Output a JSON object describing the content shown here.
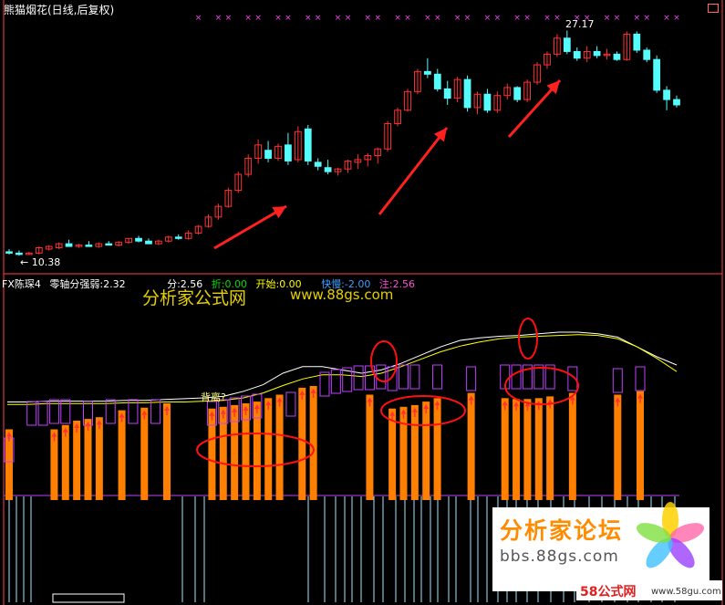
{
  "title": "熊猫烟花(日线,后复权)",
  "price_high_label": "27.17",
  "price_low_label": "10.38",
  "indicator": {
    "name": "FX陈琛4",
    "zero_axis": "零轴分强弱:2.32",
    "fen": "分:2.56",
    "zhe": "折:0.00",
    "kaishi": "开始:0.00",
    "kuaiman": "快慢:-2.00",
    "zhu": "注:2.56"
  },
  "watermark_cn": "分析家公式网",
  "watermark_url": "www.88gs.com",
  "divergence_label": "背离?",
  "forum_logo": {
    "title": "分析家论坛",
    "url": "bbs.88gs.com"
  },
  "badge": {
    "brand": "58公式网",
    "url": "www.58gu.com"
  },
  "colors": {
    "up_candle": "#ff3232",
    "down_candle": "#54fcfc",
    "ma_white": "#ffffff",
    "ma_yellow": "#ffff00",
    "bar_orange": "#ff7f00",
    "box_magenta": "#c040ff",
    "arrow_red": "#ff2020",
    "marker_magenta": "#ff40ff"
  },
  "chart_data": {
    "type": "candlestick",
    "annotation_high": 27.17,
    "annotation_low": 10.38,
    "candles": [
      {
        "o": 10.6,
        "h": 10.8,
        "l": 10.4,
        "c": 10.5
      },
      {
        "o": 10.5,
        "h": 10.7,
        "l": 10.3,
        "c": 10.4
      },
      {
        "o": 10.4,
        "h": 10.6,
        "l": 10.38,
        "c": 10.5
      },
      {
        "o": 10.5,
        "h": 11.0,
        "l": 10.4,
        "c": 10.9
      },
      {
        "o": 10.8,
        "h": 11.1,
        "l": 10.7,
        "c": 11.0
      },
      {
        "o": 10.9,
        "h": 11.3,
        "l": 10.8,
        "c": 11.2
      },
      {
        "o": 11.2,
        "h": 11.5,
        "l": 11.0,
        "c": 11.0
      },
      {
        "o": 11.0,
        "h": 11.2,
        "l": 10.9,
        "c": 11.1
      },
      {
        "o": 11.1,
        "h": 11.4,
        "l": 11.0,
        "c": 11.0
      },
      {
        "o": 11.0,
        "h": 11.3,
        "l": 10.9,
        "c": 11.2
      },
      {
        "o": 11.2,
        "h": 11.4,
        "l": 11.1,
        "c": 11.1
      },
      {
        "o": 11.1,
        "h": 11.4,
        "l": 11.0,
        "c": 11.3
      },
      {
        "o": 11.3,
        "h": 11.6,
        "l": 11.2,
        "c": 11.6
      },
      {
        "o": 11.6,
        "h": 11.8,
        "l": 11.3,
        "c": 11.4
      },
      {
        "o": 11.4,
        "h": 11.6,
        "l": 11.2,
        "c": 11.2
      },
      {
        "o": 11.2,
        "h": 11.5,
        "l": 11.1,
        "c": 11.4
      },
      {
        "o": 11.4,
        "h": 11.8,
        "l": 11.3,
        "c": 11.7
      },
      {
        "o": 11.7,
        "h": 11.9,
        "l": 11.5,
        "c": 11.6
      },
      {
        "o": 11.6,
        "h": 12.2,
        "l": 11.5,
        "c": 12.0
      },
      {
        "o": 12.0,
        "h": 12.6,
        "l": 11.9,
        "c": 12.5
      },
      {
        "o": 12.5,
        "h": 13.4,
        "l": 12.4,
        "c": 13.2
      },
      {
        "o": 13.2,
        "h": 14.2,
        "l": 13.0,
        "c": 14.0
      },
      {
        "o": 14.0,
        "h": 15.4,
        "l": 13.9,
        "c": 15.2
      },
      {
        "o": 15.2,
        "h": 16.6,
        "l": 15.0,
        "c": 16.4
      },
      {
        "o": 16.4,
        "h": 17.9,
        "l": 16.2,
        "c": 17.6
      },
      {
        "o": 17.6,
        "h": 19.0,
        "l": 17.2,
        "c": 18.6
      },
      {
        "o": 18.2,
        "h": 18.9,
        "l": 17.3,
        "c": 17.6
      },
      {
        "o": 17.6,
        "h": 18.7,
        "l": 17.4,
        "c": 18.5
      },
      {
        "o": 18.6,
        "h": 19.5,
        "l": 17.1,
        "c": 17.4
      },
      {
        "o": 17.5,
        "h": 20.0,
        "l": 17.3,
        "c": 19.6
      },
      {
        "o": 19.8,
        "h": 20.1,
        "l": 17.1,
        "c": 17.4
      },
      {
        "o": 17.3,
        "h": 17.6,
        "l": 16.7,
        "c": 17.0
      },
      {
        "o": 16.9,
        "h": 17.5,
        "l": 16.4,
        "c": 16.6
      },
      {
        "o": 16.6,
        "h": 16.9,
        "l": 16.3,
        "c": 16.8
      },
      {
        "o": 16.8,
        "h": 17.5,
        "l": 16.5,
        "c": 17.4
      },
      {
        "o": 17.3,
        "h": 17.9,
        "l": 16.8,
        "c": 17.5
      },
      {
        "o": 17.5,
        "h": 18.0,
        "l": 17.0,
        "c": 17.8
      },
      {
        "o": 17.8,
        "h": 18.4,
        "l": 17.2,
        "c": 18.3
      },
      {
        "o": 18.3,
        "h": 20.4,
        "l": 18.1,
        "c": 20.2
      },
      {
        "o": 20.2,
        "h": 21.4,
        "l": 20.0,
        "c": 21.2
      },
      {
        "o": 21.2,
        "h": 22.8,
        "l": 21.1,
        "c": 22.6
      },
      {
        "o": 22.6,
        "h": 24.3,
        "l": 22.4,
        "c": 24.1
      },
      {
        "o": 24.1,
        "h": 25.1,
        "l": 23.6,
        "c": 23.9
      },
      {
        "o": 23.9,
        "h": 24.3,
        "l": 22.6,
        "c": 22.8
      },
      {
        "o": 22.8,
        "h": 23.4,
        "l": 21.6,
        "c": 22.1
      },
      {
        "o": 22.1,
        "h": 23.7,
        "l": 21.8,
        "c": 23.5
      },
      {
        "o": 23.5,
        "h": 23.8,
        "l": 21.1,
        "c": 21.4
      },
      {
        "o": 21.4,
        "h": 22.6,
        "l": 20.9,
        "c": 22.4
      },
      {
        "o": 22.4,
        "h": 22.8,
        "l": 21.0,
        "c": 21.2
      },
      {
        "o": 21.2,
        "h": 22.6,
        "l": 21.0,
        "c": 22.3
      },
      {
        "o": 22.3,
        "h": 23.2,
        "l": 22.0,
        "c": 22.9
      },
      {
        "o": 22.9,
        "h": 23.0,
        "l": 21.8,
        "c": 22.0
      },
      {
        "o": 22.0,
        "h": 23.5,
        "l": 21.8,
        "c": 23.3
      },
      {
        "o": 23.3,
        "h": 24.8,
        "l": 23.1,
        "c": 24.6
      },
      {
        "o": 24.6,
        "h": 25.6,
        "l": 24.3,
        "c": 25.4
      },
      {
        "o": 25.4,
        "h": 26.9,
        "l": 25.2,
        "c": 26.6
      },
      {
        "o": 26.6,
        "h": 27.17,
        "l": 25.4,
        "c": 25.6
      },
      {
        "o": 25.6,
        "h": 25.9,
        "l": 24.9,
        "c": 25.1
      },
      {
        "o": 25.1,
        "h": 26.0,
        "l": 24.8,
        "c": 25.6
      },
      {
        "o": 25.6,
        "h": 26.0,
        "l": 25.1,
        "c": 25.3
      },
      {
        "o": 25.3,
        "h": 25.8,
        "l": 25.0,
        "c": 25.4
      },
      {
        "o": 25.4,
        "h": 25.6,
        "l": 24.9,
        "c": 25.0
      },
      {
        "o": 25.0,
        "h": 27.1,
        "l": 24.9,
        "c": 26.9
      },
      {
        "o": 26.9,
        "h": 27.1,
        "l": 25.5,
        "c": 25.7
      },
      {
        "o": 25.7,
        "h": 25.9,
        "l": 24.8,
        "c": 25.0
      },
      {
        "o": 25.0,
        "h": 25.3,
        "l": 22.5,
        "c": 22.7
      },
      {
        "o": 22.7,
        "h": 23.0,
        "l": 21.2,
        "c": 22.0
      },
      {
        "o": 22.0,
        "h": 22.3,
        "l": 21.4,
        "c": 21.6
      }
    ],
    "indicator_bars": {
      "orange": [
        0.5,
        0,
        0,
        0,
        0.5,
        0.55,
        0.6,
        0.62,
        0.64,
        0,
        0.72,
        0,
        0.75,
        0,
        0.8,
        0,
        0,
        0,
        0.74,
        0.76,
        0.78,
        0.8,
        0.82,
        0.86,
        0.9,
        0,
        0.98,
        1.0,
        0,
        0,
        0,
        0,
        0.9,
        0,
        0.74,
        0.76,
        0.78,
        0.82,
        0.86,
        0,
        0,
        0.92,
        0,
        0,
        0.86,
        0.85,
        0.85,
        0.86,
        0.88,
        0,
        0.92,
        0,
        0,
        0,
        0.9,
        0,
        0.94
      ],
      "box": [
        0.2,
        0,
        0.6,
        0.6,
        0.62,
        0.62,
        0,
        0.6,
        0,
        0.62,
        0,
        0.62,
        0,
        0.62,
        0,
        0,
        0,
        0,
        0.6,
        0.62,
        0.64,
        0.66,
        0.68,
        0,
        0,
        0.7,
        0,
        0,
        0.92,
        0.95,
        0.97,
        0.99,
        0.99,
        1.0,
        0.98,
        1.0,
        1.0,
        0,
        1.0,
        0,
        0,
        0.98,
        0,
        0,
        1.0,
        1.0,
        1.0,
        1.0,
        1.0,
        0,
        0.98,
        0,
        0,
        0,
        0.96,
        0,
        0.98
      ],
      "up_arrow": [
        1,
        0,
        0,
        0,
        1,
        1,
        1,
        1,
        1,
        0,
        1,
        0,
        1,
        0,
        1,
        0,
        0,
        0,
        1,
        1,
        1,
        1,
        1,
        1,
        1,
        0,
        1,
        1,
        0,
        0,
        0,
        0,
        1,
        0,
        1,
        1,
        1,
        1,
        1,
        0,
        0,
        1,
        0,
        0,
        1,
        1,
        1,
        1,
        1,
        0,
        1,
        0,
        0,
        0,
        1,
        0,
        1
      ]
    },
    "ma_white": [
      0.05,
      0.05,
      0.06,
      0.06,
      0.06,
      0.06,
      0.07,
      0.07,
      0.08,
      0.09,
      0.1,
      0.12,
      0.18,
      0.26,
      0.4,
      0.48,
      0.48,
      0.44,
      0.4,
      0.44,
      0.52,
      0.62,
      0.72,
      0.8,
      0.83,
      0.85,
      0.86,
      0.88,
      0.9,
      0.9,
      0.88,
      0.84,
      0.72,
      0.6,
      0.5
    ],
    "ma_yellow": [
      0.02,
      0.02,
      0.03,
      0.03,
      0.03,
      0.03,
      0.04,
      0.04,
      0.05,
      0.05,
      0.06,
      0.07,
      0.1,
      0.16,
      0.25,
      0.33,
      0.38,
      0.38,
      0.36,
      0.4,
      0.48,
      0.57,
      0.66,
      0.73,
      0.78,
      0.82,
      0.84,
      0.85,
      0.86,
      0.87,
      0.86,
      0.82,
      0.72,
      0.58,
      0.42
    ]
  }
}
